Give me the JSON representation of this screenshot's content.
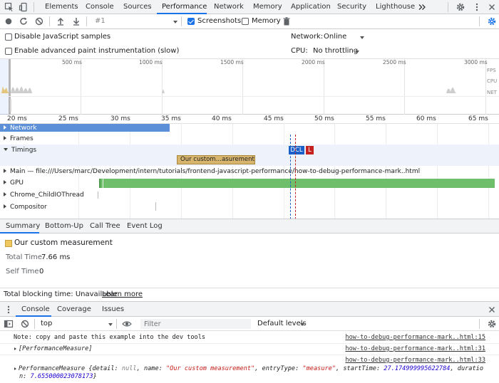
{
  "devtools_tabs": [
    "Elements",
    "Console",
    "Sources",
    "Performance",
    "Network",
    "Memory",
    "Application",
    "Security",
    "Lighthouse"
  ],
  "toolbar": {
    "profile_select": "#1",
    "screenshots_label": "Screenshots",
    "memory_label": "Memory"
  },
  "settings": {
    "disable_js_samples": "Disable JavaScript samples",
    "advanced_paint": "Enable advanced paint instrumentation (slow)",
    "network_label": "Network:",
    "network_value": "Online",
    "cpu_label": "CPU:",
    "cpu_value": "No throttling"
  },
  "overview": {
    "ticks": [
      "500 ms",
      "1000 ms",
      "1500 ms",
      "2000 ms",
      "2500 ms",
      "3000 ms"
    ],
    "side_labels": [
      "FPS",
      "CPU",
      "NET"
    ]
  },
  "ruler": {
    "ticks": [
      "20 ms",
      "25 ms",
      "30 ms",
      "35 ms",
      "40 ms",
      "45 ms",
      "50 ms",
      "55 ms",
      "60 ms",
      "65 ms"
    ]
  },
  "tracks": {
    "network": "Network",
    "frames": "Frames",
    "timings": "Timings",
    "measure_label": "Our custom…asurement",
    "dcl": "DCL",
    "load": "L",
    "main": "Main — file:///Users/marc/Development/intern/tutorials/frontend-javascript-performance/how-to-debug-performance-mark..html",
    "gpu": "GPU",
    "child_io": "Chrome_ChildIOThread",
    "compositor": "Compositor"
  },
  "detail_tabs": [
    "Summary",
    "Bottom-Up",
    "Call Tree",
    "Event Log"
  ],
  "summary": {
    "title": "Our custom measurement",
    "total_time_label": "Total Time",
    "total_time_value": "7.66 ms",
    "self_time_label": "Self Time",
    "self_time_value": "0",
    "swatch_color": "#f0c75e"
  },
  "tbt": {
    "text": "Total blocking time: Unavailable",
    "link": "Learn more"
  },
  "drawer": {
    "tabs": [
      "Console",
      "Coverage",
      "Issues"
    ],
    "context": "top",
    "filter_placeholder": "Filter",
    "levels": "Default levels"
  },
  "console": {
    "line1": "Note: copy and paste this example into the dev tools",
    "line1_src": "how-to-debug-performance-mark..html:15",
    "line2": "[PerformanceMeasure]",
    "line2_src": "how-to-debug-performance-mark..html:31",
    "line3_src": "how-to-debug-performance-mark..html:33",
    "line3": {
      "prefix": "PerformanceMeasure {",
      "k_detail": "detail: ",
      "v_detail": "null",
      "k_name": ", name: ",
      "v_name": "\"Our custom measurement\"",
      "k_entry": ", entryType: ",
      "v_entry": "\"measure\"",
      "k_start": ", startTime: ",
      "v_start": "27.174999995622784",
      "k_dur": ", duratio",
      "cont_prefix": "n: ",
      "v_dur": "7.655000023078173",
      "suffix": "}"
    }
  },
  "colors": {
    "accent": "#1a73e8",
    "network_bar": "#5b8fd8",
    "gpu_bar": "#6fbe6b",
    "measure_bar": "#d7b56d",
    "dcl": "#1a60c8",
    "load": "#c5221f"
  }
}
